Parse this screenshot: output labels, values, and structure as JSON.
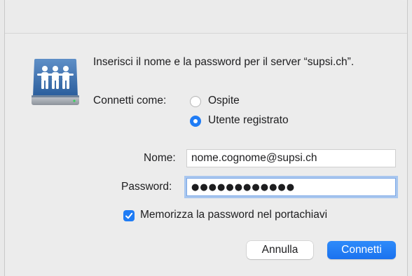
{
  "dialog": {
    "prompt": "Inserisci il nome e la password per il server “supsi.ch”.",
    "icon": "shared-server-icon",
    "connect_as_label": "Connetti come:",
    "options": [
      {
        "label": "Ospite",
        "selected": false
      },
      {
        "label": "Utente registrato",
        "selected": true
      }
    ],
    "name_label": "Nome:",
    "name_value": "nome.cognome@supsi.ch",
    "password_label": "Password:",
    "password_value": "●●●●●●●●●●●●",
    "remember_label": "Memorizza la password nel portachiavi",
    "remember_checked": true,
    "cancel_label": "Annulla",
    "connect_label": "Connetti"
  },
  "colors": {
    "accent": "#1f7cf5",
    "focus_ring": "#a9c7ef"
  }
}
